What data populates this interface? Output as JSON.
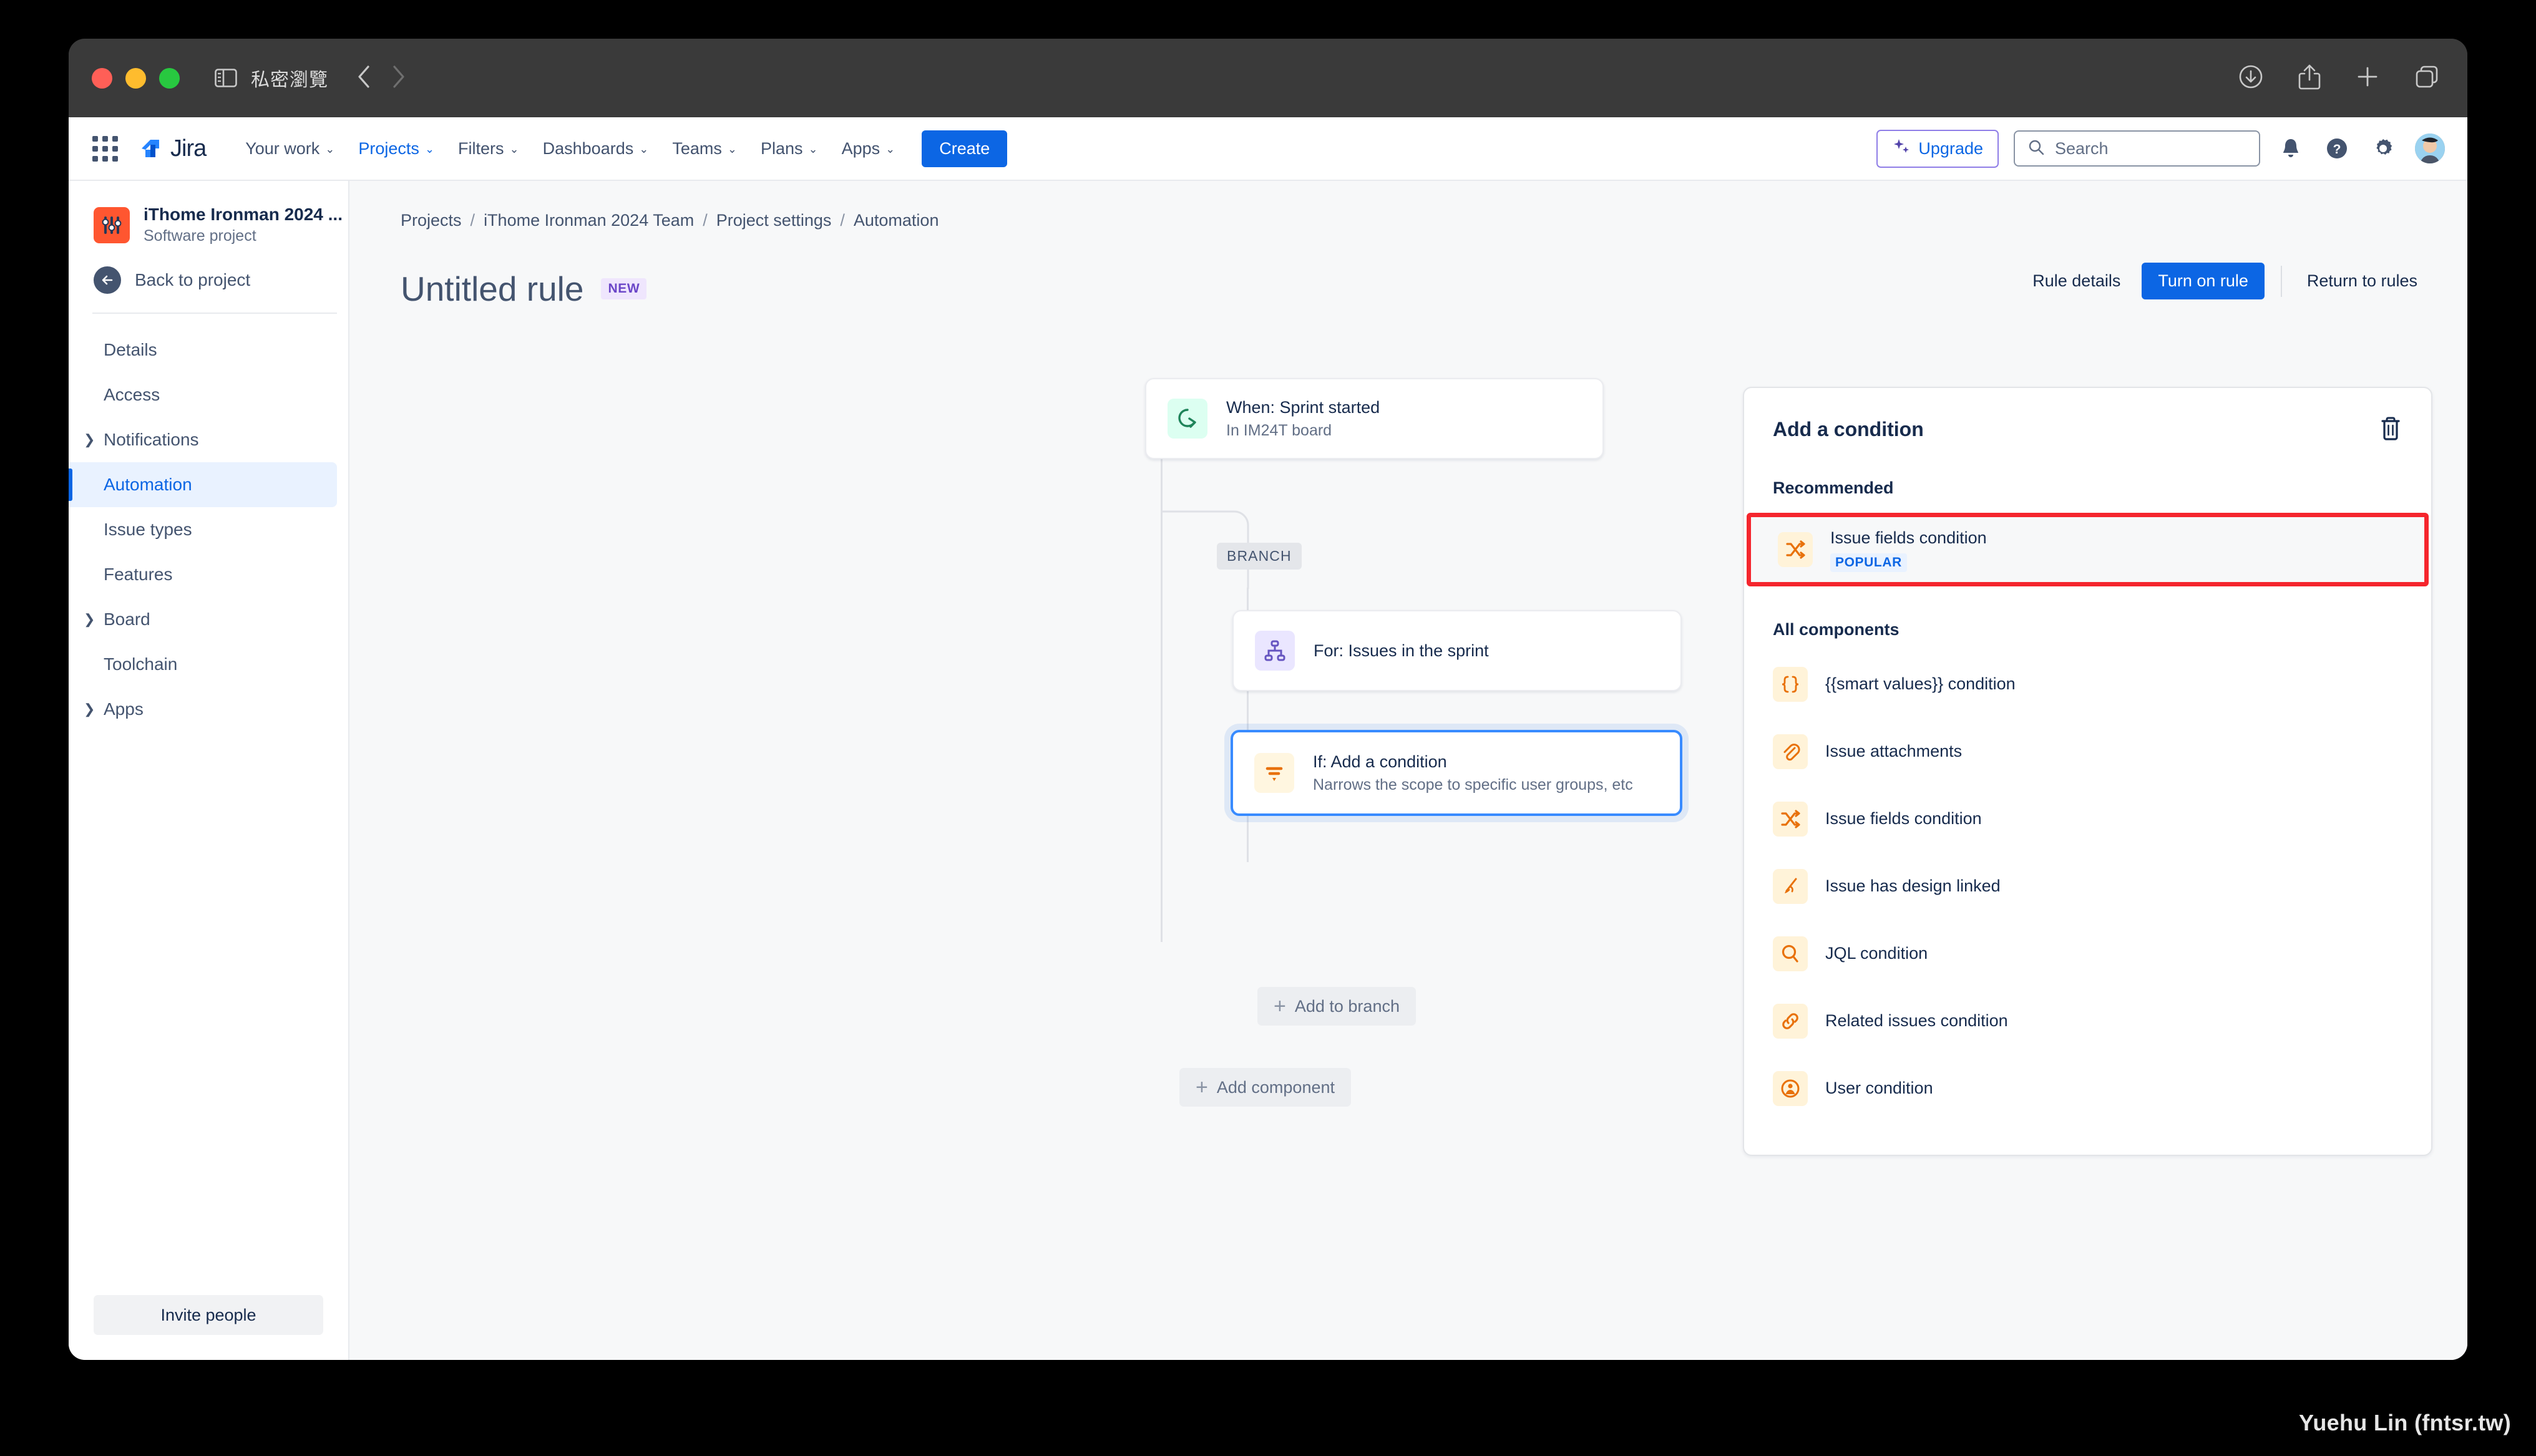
{
  "browser": {
    "private_label": "私密瀏覽",
    "back_icon": "chevron-left-icon",
    "forward_icon": "chevron-right-icon",
    "sidebar_icon": "sidebar-toggle-icon",
    "download_icon": "download-icon",
    "share_icon": "share-icon",
    "newtab_icon": "plus-icon",
    "tabs_icon": "tab-overview-icon"
  },
  "global_nav": {
    "brand": "Jira",
    "app_switcher_icon": "grid-apps-icon",
    "items": [
      {
        "label": "Your work",
        "has_caret": true,
        "active": false
      },
      {
        "label": "Projects",
        "has_caret": true,
        "active": true
      },
      {
        "label": "Filters",
        "has_caret": true,
        "active": false
      },
      {
        "label": "Dashboards",
        "has_caret": true,
        "active": false
      },
      {
        "label": "Teams",
        "has_caret": true,
        "active": false
      },
      {
        "label": "Plans",
        "has_caret": true,
        "active": false
      },
      {
        "label": "Apps",
        "has_caret": true,
        "active": false
      }
    ],
    "create_label": "Create",
    "upgrade_label": "Upgrade",
    "upgrade_icon": "sparkles-icon",
    "search_placeholder": "Search",
    "search_value": "",
    "search_icon": "search-icon",
    "notification_icon": "notification-bell-icon",
    "help_icon": "help-circle-icon",
    "settings_icon": "gear-icon",
    "avatar_icon": "user-avatar"
  },
  "sidebar": {
    "project_name": "iThome Ironman 2024 ...",
    "project_type": "Software project",
    "project_icon": "sliders-icon",
    "back_label": "Back to project",
    "back_icon": "arrow-left-icon",
    "items": [
      {
        "label": "Details",
        "expandable": false,
        "active": false
      },
      {
        "label": "Access",
        "expandable": false,
        "active": false
      },
      {
        "label": "Notifications",
        "expandable": true,
        "active": false
      },
      {
        "label": "Automation",
        "expandable": false,
        "active": true
      },
      {
        "label": "Issue types",
        "expandable": false,
        "active": false
      },
      {
        "label": "Features",
        "expandable": false,
        "active": false
      },
      {
        "label": "Board",
        "expandable": true,
        "active": false
      },
      {
        "label": "Toolchain",
        "expandable": false,
        "active": false
      },
      {
        "label": "Apps",
        "expandable": true,
        "active": false
      }
    ],
    "invite_label": "Invite people"
  },
  "breadcrumb": [
    "Projects",
    "iThome Ironman 2024 Team",
    "Project settings",
    "Automation"
  ],
  "page": {
    "title": "Untitled rule",
    "badge": "NEW",
    "rule_details_label": "Rule details",
    "turn_on_label": "Turn on rule",
    "return_label": "Return to rules"
  },
  "canvas": {
    "branch_tag": "BRANCH",
    "add_to_branch_label": "Add to branch",
    "add_component_label": "Add component",
    "nodes": [
      {
        "title": "When: Sprint started",
        "subtitle": "In IM24T board",
        "icon": "sprint-started-icon",
        "selected": false
      },
      {
        "title": "For: Issues in the sprint",
        "subtitle": "",
        "icon": "branch-tree-icon",
        "selected": false
      },
      {
        "title": "If: Add a condition",
        "subtitle": "Narrows the scope to specific user groups, etc",
        "icon": "filter-icon",
        "selected": true
      }
    ]
  },
  "right_panel": {
    "title": "Add a condition",
    "delete_icon": "trash-icon",
    "recommended_heading": "Recommended",
    "recommended": [
      {
        "label": "Issue fields condition",
        "badge": "POPULAR",
        "icon": "shuffle-icon"
      }
    ],
    "all_components_heading": "All components",
    "all_components": [
      {
        "label": "{{smart values}} condition",
        "icon": "braces-icon"
      },
      {
        "label": "Issue attachments",
        "icon": "paperclip-icon"
      },
      {
        "label": "Issue fields condition",
        "icon": "shuffle-icon"
      },
      {
        "label": "Issue has design linked",
        "icon": "design-pen-icon"
      },
      {
        "label": "JQL condition",
        "icon": "search-icon"
      },
      {
        "label": "Related issues condition",
        "icon": "link-icon"
      },
      {
        "label": "User condition",
        "icon": "user-circle-icon"
      }
    ]
  },
  "watermark": "Yuehu Lin (fntsr.tw)",
  "colors": {
    "accent_blue": "#0c66e4",
    "highlight_red": "#f5252d",
    "orange_icon": "#e8710a",
    "project_orange": "#ff5630",
    "purple_badge": "#6b46c8"
  }
}
